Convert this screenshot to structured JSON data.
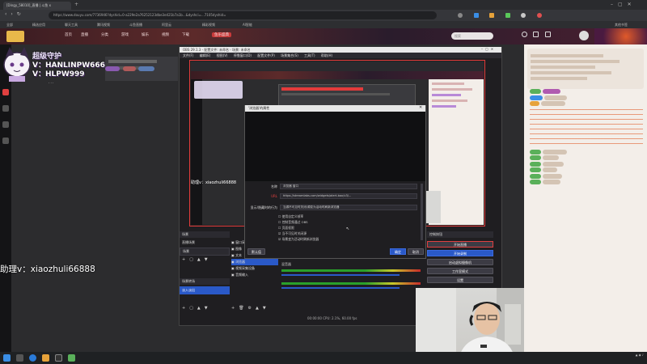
{
  "browser": {
    "tab1": "[Dingy_58010]_直播 | 斗鱼 x",
    "tab2": "",
    "url": "https://www.douyu.com/7736946?dyshid=0-a229e2a76252123dbe3e421b7a1b...&dyshci=...7105dyshid=",
    "bookmarks": [
      "全部",
      "精选应用",
      "聊天工具",
      "腾讯视频",
      "斗鱼直播",
      "阿里云",
      "精彩视频",
      "AI智能",
      "其他书签"
    ]
  },
  "site": {
    "nav": [
      "首页",
      "直播",
      "分类",
      "游戏",
      "娱乐",
      "视频",
      "下载",
      "鱼乐盛典"
    ],
    "search_placeholder": "搜索",
    "user_icons": [
      "历史",
      "关注",
      "消息",
      "头像"
    ]
  },
  "overlay": {
    "line1": "超级守护",
    "line2": "V：HANLINPW666",
    "line3": "V：HLPW999",
    "assistant": "助理v：xiaozhuli66888"
  },
  "obs": {
    "title": "OBS 29.1.3 - 配置文件: 未命名 - 场景: 未命名",
    "menu": [
      "文件(F)",
      "编辑(E)",
      "视图(V)",
      "停靠窗口(D)",
      "配置文件(P)",
      "场景集合(S)",
      "工具(T)",
      "帮助(H)"
    ],
    "preview_caption": "助理v：xiaozhuli66888",
    "docks": {
      "scenes": "场景",
      "sources": "来源",
      "mixer": "混音器",
      "transitions": "场景转场",
      "controls": "控制按钮"
    },
    "scene_items": [
      "直播场景",
      "场景"
    ],
    "source_items": [
      "窗口采集",
      "图像",
      "文本",
      "浏览器",
      "视频采集设备",
      "音频输入"
    ],
    "transition_value": "淡入淡出",
    "controls": {
      "start_stream": "开始直播",
      "start_record": "开始录制",
      "virtual_cam": "启动虚拟摄像机",
      "studio_mode": "工作室模式",
      "settings": "设置",
      "exit": "退出"
    },
    "status_bar": "00:00:00  CPU: 2.1%, 60.00 fps"
  },
  "dialog": {
    "title": "'浏览器'的属性",
    "labels": {
      "name": "名称",
      "url": "URL",
      "mode": "显示/隐藏时的行为"
    },
    "values": {
      "name": "浏览器 窗口",
      "url": "https://streamlabs.com/widgets/alert-box/v3/...",
      "mode": "当源不可见时关闭/源变为活动时刷新浏览器"
    },
    "checkboxes": [
      "使用自定义帧率",
      "控制音频通过 OBS",
      "页面权限",
      "当不可见时关闭源",
      "场景变为活动时刷新浏览器"
    ],
    "defaults_btn": "默认值",
    "ok_btn": "确定",
    "cancel_btn": "取消"
  },
  "colors": {
    "accent_red": "#e23b3b",
    "obs_blue": "#2a59c8",
    "chat_orange": "#e0541f"
  }
}
